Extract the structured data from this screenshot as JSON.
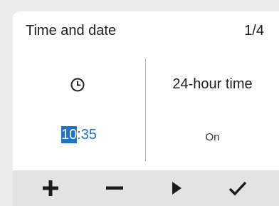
{
  "header": {
    "title": "Time and date",
    "page_indicator": "1/4"
  },
  "time_setting": {
    "icon": "clock-icon",
    "hours": "10",
    "separator": ":",
    "minutes": "35"
  },
  "hour_format_setting": {
    "label": "24-hour time",
    "value": "On"
  },
  "toolbar": {
    "buttons": [
      {
        "icon": "plus-icon"
      },
      {
        "icon": "minus-icon"
      },
      {
        "icon": "play-icon"
      },
      {
        "icon": "checkmark-icon"
      }
    ]
  },
  "colors": {
    "accent": "#1e73c8",
    "text": "#1e1e1e",
    "toolbar_bg": "#e3e3e3",
    "screen_bg": "#ffffff"
  }
}
